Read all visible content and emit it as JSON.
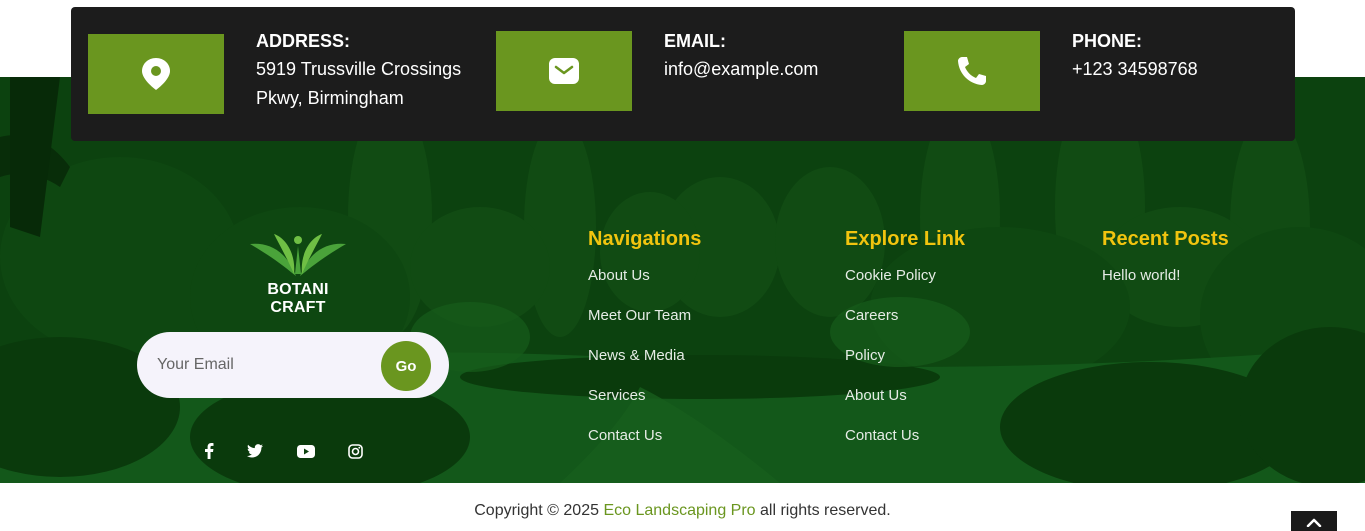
{
  "contact": {
    "address": {
      "label": "ADDRESS:",
      "line1": "5919 Trussville Crossings",
      "line2": "Pkwy, Birmingham"
    },
    "email": {
      "label": "EMAIL:",
      "value": "info@example.com"
    },
    "phone": {
      "label": "PHONE:",
      "value": "+123 34598768"
    }
  },
  "brand": {
    "name": "BOTANI CRAFT"
  },
  "newsletter": {
    "placeholder": "Your Email",
    "button": "Go"
  },
  "social": [
    "facebook-icon",
    "twitter-icon",
    "youtube-icon",
    "instagram-icon"
  ],
  "columns": {
    "navigations": {
      "title": "Navigations",
      "links": [
        "About Us",
        "Meet Our Team",
        "News & Media",
        "Services",
        "Contact Us"
      ]
    },
    "explore": {
      "title": "Explore Link",
      "links": [
        "Cookie Policy",
        "Careers",
        "Policy",
        "About Us",
        "Contact Us"
      ]
    },
    "recent": {
      "title": "Recent Posts",
      "links": [
        "Hello world!"
      ]
    }
  },
  "copyright": {
    "prefix": "Copyright © 2025 ",
    "brand": "Eco Landscaping Pro",
    "suffix": " all rights reserved."
  },
  "colors": {
    "accent": "#6a961f",
    "heading": "#f1c40f",
    "bar": "#1c1c1c"
  }
}
